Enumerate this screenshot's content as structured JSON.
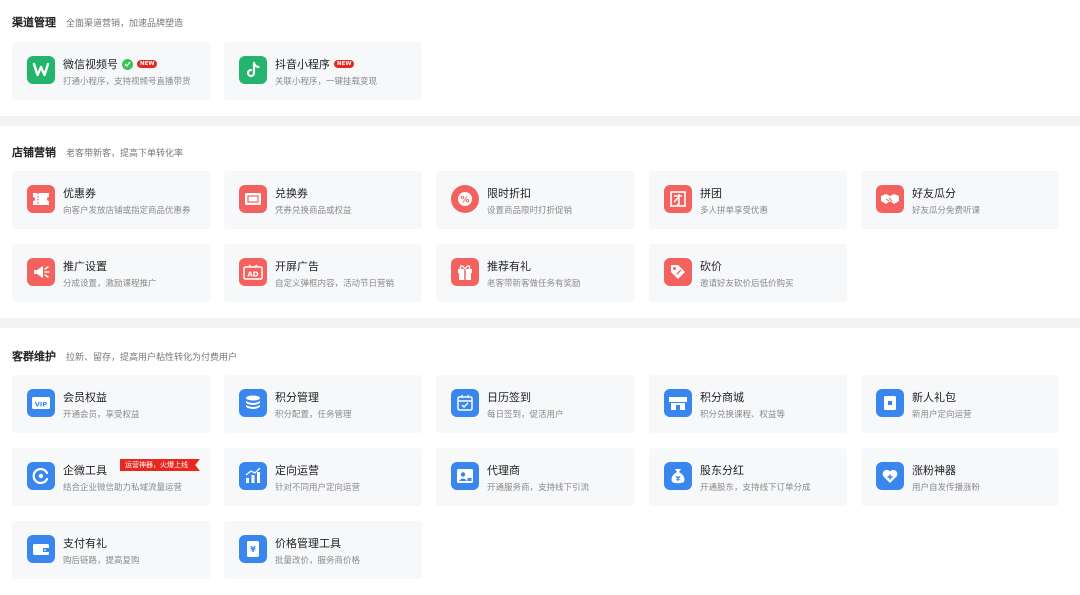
{
  "sections": [
    {
      "title": "渠道管理",
      "subtitle": "全面渠道营销，加速品牌塑造",
      "cards": [
        {
          "name": "微信视频号",
          "desc": "打通小程序，支持视频号直播带货",
          "icon": "wechat-channels-icon",
          "badge_new": "NEW"
        },
        {
          "name": "抖音小程序",
          "desc": "关联小程序，一键挂载变现",
          "icon": "douyin-icon",
          "badge_new": "NEW"
        }
      ]
    },
    {
      "title": "店铺营销",
      "subtitle": "老客带新客，提高下单转化率",
      "cards": [
        {
          "name": "优惠券",
          "desc": "向客户发放店铺或指定商品优惠券",
          "icon": "coupon-icon"
        },
        {
          "name": "兑换券",
          "desc": "凭券兑换商品或权益",
          "icon": "voucher-icon"
        },
        {
          "name": "限时折扣",
          "desc": "设置商品限时打折促销",
          "icon": "percent-discount-icon"
        },
        {
          "name": "拼团",
          "desc": "多人拼单享受优惠",
          "icon": "group-buy-icon"
        },
        {
          "name": "好友瓜分",
          "desc": "好友瓜分免费听课",
          "icon": "handshake-icon"
        },
        {
          "name": "推广设置",
          "desc": "分成设置，激励课程推广",
          "icon": "megaphone-icon"
        },
        {
          "name": "开屏广告",
          "desc": "自定义弹框内容，活动节日营销",
          "icon": "ad-icon"
        },
        {
          "name": "推荐有礼",
          "desc": "老客带新客做任务有奖励",
          "icon": "gift-icon"
        },
        {
          "name": "砍价",
          "desc": "邀请好友砍价后低价购买",
          "icon": "price-tag-icon"
        }
      ]
    },
    {
      "title": "客群维护",
      "subtitle": "拉新、留存，提高用户粘性转化为付费用户",
      "cards": [
        {
          "name": "会员权益",
          "desc": "开通会员，享受权益",
          "icon": "vip-card-icon"
        },
        {
          "name": "积分管理",
          "desc": "积分配置，任务管理",
          "icon": "coin-stack-icon"
        },
        {
          "name": "日历签到",
          "desc": "每日签到，促活用户",
          "icon": "calendar-check-icon"
        },
        {
          "name": "积分商城",
          "desc": "积分兑换课程、权益等",
          "icon": "store-icon"
        },
        {
          "name": "新人礼包",
          "desc": "新用户定向运营",
          "icon": "gift-box-icon"
        },
        {
          "name": "企微工具",
          "desc": "结合企业微信助力私域流量运营",
          "icon": "wecom-icon",
          "promo": "运营神器，火爆上线"
        },
        {
          "name": "定向运营",
          "desc": "针对不同用户定向运营",
          "icon": "bar-chart-icon"
        },
        {
          "name": "代理商",
          "desc": "开通服务商，支持线下引流",
          "icon": "agent-icon"
        },
        {
          "name": "股东分红",
          "desc": "开通股东，支持线下订单分成",
          "icon": "money-bag-icon"
        },
        {
          "name": "涨粉神器",
          "desc": "用户自发传播涨粉",
          "icon": "heart-plus-icon"
        },
        {
          "name": "支付有礼",
          "desc": "购后链路，提高复购",
          "icon": "wallet-icon"
        },
        {
          "name": "价格管理工具",
          "desc": "批量改价，服务商价格",
          "icon": "price-doc-icon"
        }
      ]
    }
  ],
  "colors": {
    "red_icon": "#f4625f",
    "blue_icon": "#3a86ef",
    "green_icon": "#3cc257",
    "new_badge": "#e8271f"
  }
}
